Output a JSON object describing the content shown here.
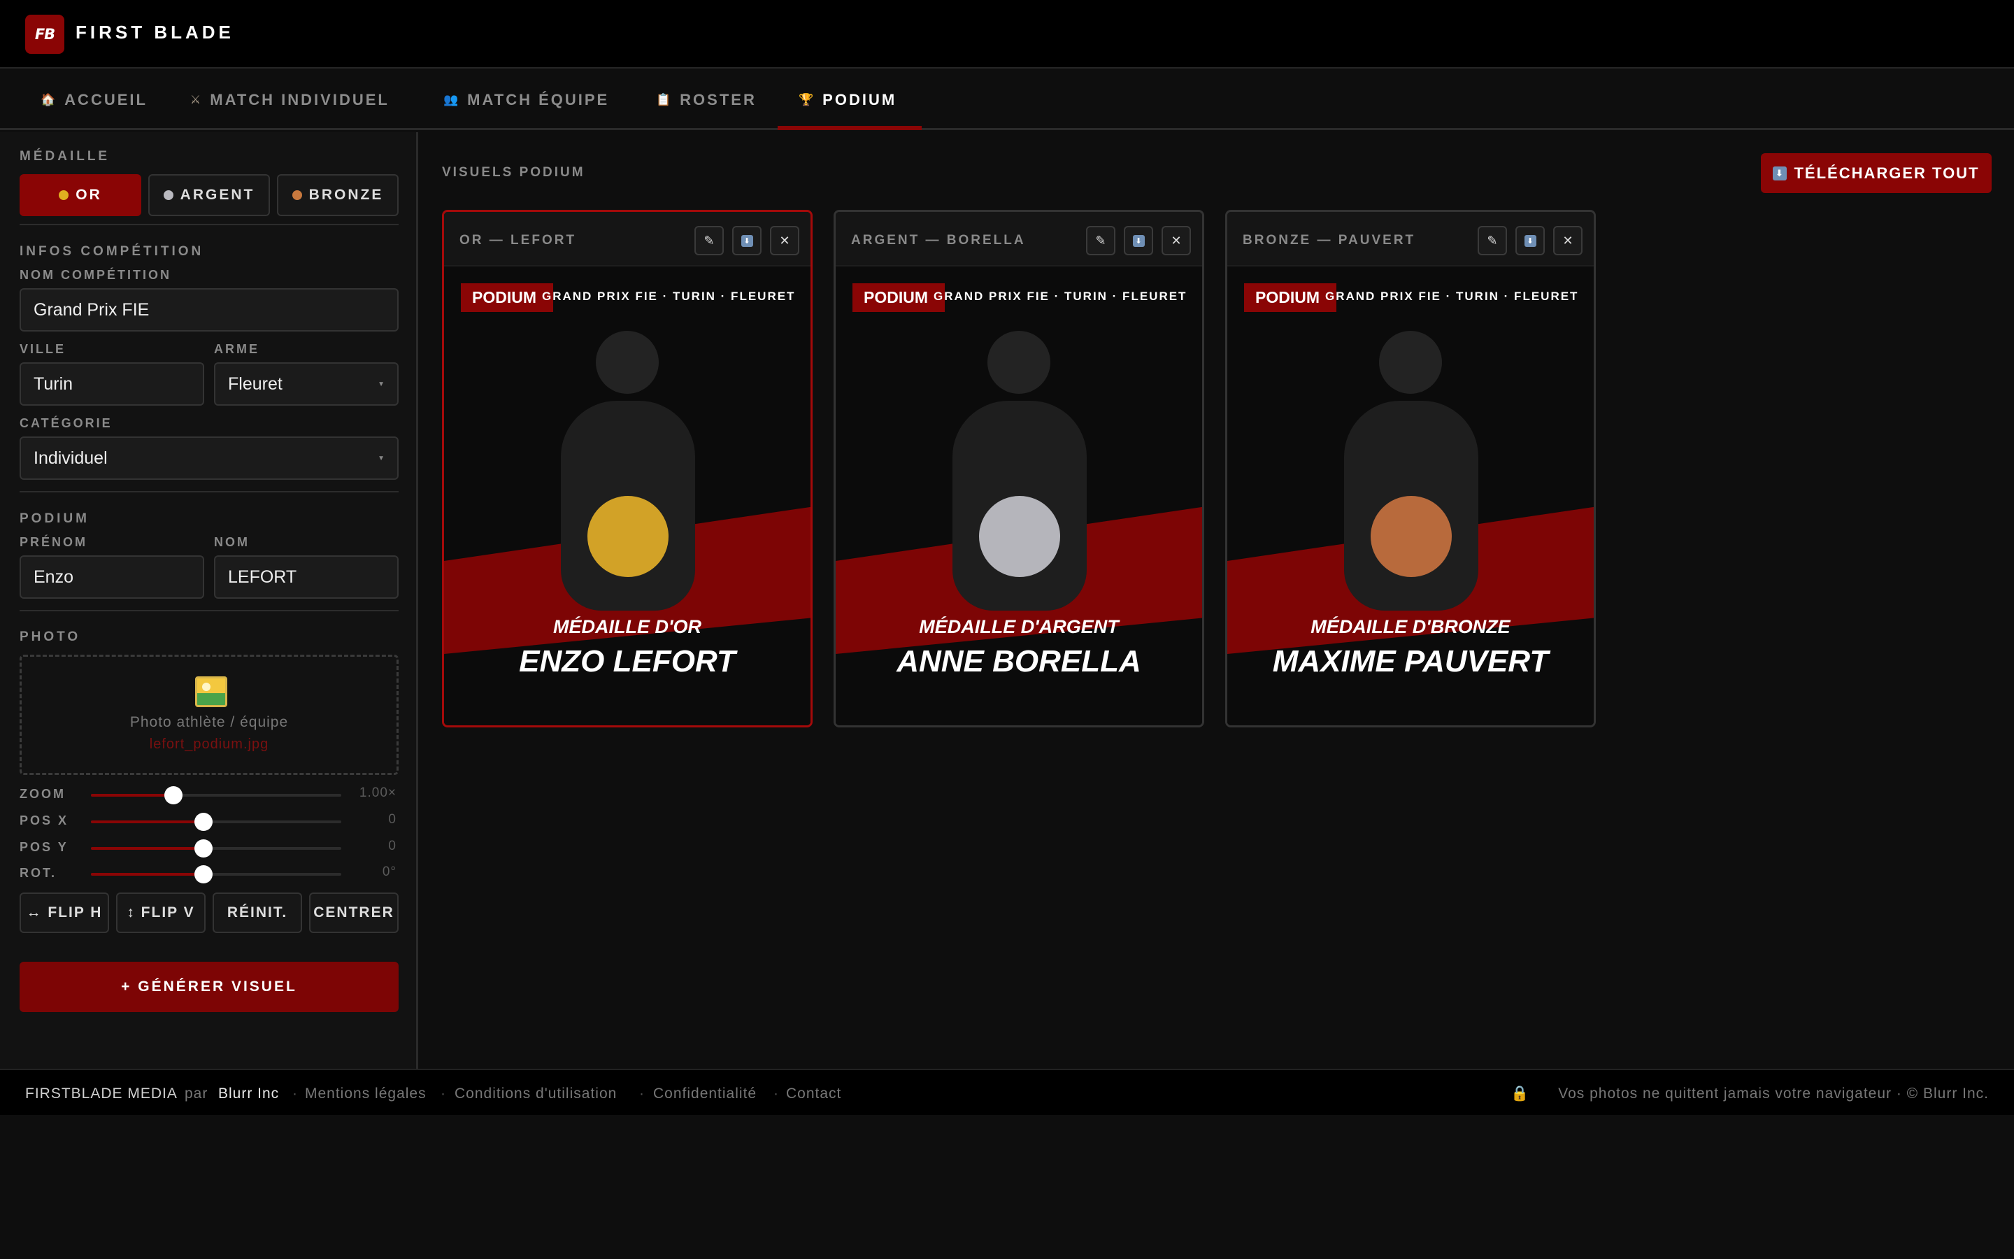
{
  "header": {
    "logo": "FB",
    "title": "FIRST BLADE"
  },
  "nav": {
    "tabs": [
      {
        "icon": "house-icon",
        "glyph": "🏠",
        "label": "ACCUEIL"
      },
      {
        "icon": "crossed-swords-icon",
        "glyph": "⚔",
        "label": "MATCH INDIVIDUEL"
      },
      {
        "icon": "people-icon",
        "glyph": "👥",
        "label": "MATCH ÉQUIPE"
      },
      {
        "icon": "clipboard-icon",
        "glyph": "📋",
        "label": "ROSTER"
      },
      {
        "icon": "trophy-icon",
        "glyph": "🏆",
        "label": "PODIUM",
        "active": true
      }
    ]
  },
  "sidebar": {
    "medal_section": "MÉDAILLE",
    "medals": [
      {
        "label": "OR",
        "color": "#e0b020",
        "active": true
      },
      {
        "label": "ARGENT",
        "color": "#b9b9bf"
      },
      {
        "label": "BRONZE",
        "color": "#c8793e"
      }
    ],
    "competition_section": "INFOS COMPÉTITION",
    "competition_name_label": "NOM COMPÉTITION",
    "competition_name": "Grand Prix FIE",
    "city_label": "VILLE",
    "city": "Turin",
    "weapon_label": "ARME",
    "weapon": "Fleuret",
    "category_label": "CATÉGORIE",
    "category": "Individuel",
    "podium_section": "PODIUM",
    "firstname_label": "PRÉNOM",
    "firstname": "Enzo",
    "lastname_label": "NOM",
    "lastname": "LEFORT",
    "photo_section": "PHOTO",
    "dropzone_text": "Photo athlète / équipe",
    "dropzone_file": "lefort_podium.jpg",
    "sliders": [
      {
        "label": "ZOOM",
        "value": "1.00×",
        "fraction": 0.33
      },
      {
        "label": "POS X",
        "value": "0",
        "fraction": 0.45
      },
      {
        "label": "POS Y",
        "value": "0",
        "fraction": 0.45
      },
      {
        "label": "ROT.",
        "value": "0°",
        "fraction": 0.45
      }
    ],
    "tools": {
      "flip_h": "↔ FLIP H",
      "flip_v": "↕ FLIP V",
      "reset": "RÉINIT.",
      "center": "CENTRER"
    },
    "generate": "+ GÉNÉRER VISUEL"
  },
  "main": {
    "title": "VISUELS PODIUM",
    "download_all": "TÉLÉCHARGER TOUT",
    "download_icon": "download-icon",
    "cards": [
      {
        "title": "OR — LEFORT",
        "tag": "PODIUM",
        "competition": "GRAND PRIX FIE · TURIN · FLEURET",
        "medal_caption": "MÉDAILLE D'OR",
        "name": "ENZO LEFORT",
        "medal_color": "#d2a227",
        "selected": true
      },
      {
        "title": "ARGENT — BORELLA",
        "tag": "PODIUM",
        "competition": "GRAND PRIX FIE · TURIN · FLEURET",
        "medal_caption": "MÉDAILLE D'ARGENT",
        "name": "ANNE BORELLA",
        "medal_color": "#b5b5bb"
      },
      {
        "title": "BRONZE — PAUVERT",
        "tag": "PODIUM",
        "competition": "GRAND PRIX FIE · TURIN · FLEURET",
        "medal_caption": "MÉDAILLE D'BRONZE",
        "name": "MAXIME PAUVERT",
        "medal_color": "#b86a3c"
      }
    ],
    "card_actions": {
      "edit": "✎",
      "download": "⬇",
      "close": "✕"
    }
  },
  "footer": {
    "brand": "FIRSTBLADE MEDIA",
    "by": "par",
    "company": "Blurr Inc",
    "links": [
      "Mentions légales",
      "Conditions d'utilisation",
      "Confidentialité",
      "Contact"
    ],
    "privacy": "Vos photos ne quittent jamais votre navigateur · © Blurr Inc.",
    "lock_icon": "lock-icon"
  },
  "colors": {
    "accent": "#8a0505",
    "background": "#0e0e0e",
    "gold": "#d2a227",
    "silver": "#b5b5bb",
    "bronze": "#b86a3c"
  }
}
